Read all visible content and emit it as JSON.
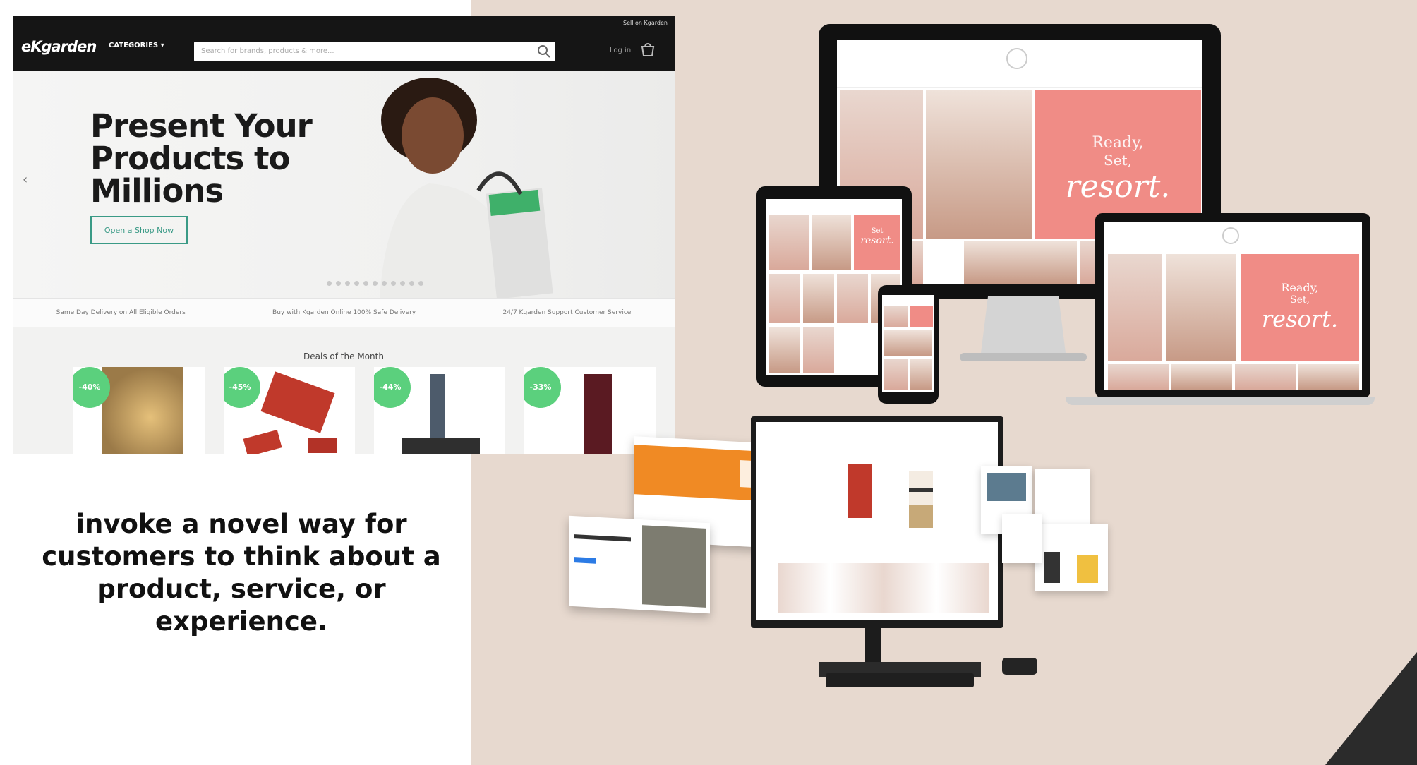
{
  "website": {
    "logo": "eKgarden",
    "categories_label": "CATEGORIES ▾",
    "search_placeholder": "Search for brands, products & more...",
    "top_link": "Sell on Kgarden",
    "login_label": "Log in",
    "hero_title": "Present Your Products to Millions",
    "cta_label": "Open a Shop Now",
    "features": [
      "Same Day Delivery on All Eligible Orders",
      "Buy with Kgarden Online 100% Safe Delivery",
      "24/7 Kgarden Support Customer Service"
    ],
    "deals_heading": "Deals of the Month",
    "products": [
      {
        "badge": "-40%"
      },
      {
        "badge": "-45%"
      },
      {
        "badge": "-44%"
      },
      {
        "badge": "-33%"
      }
    ]
  },
  "tagline": "invoke a novel way for customers to think about a product, service, or experience.",
  "devices": {
    "desktop_promo": {
      "line1": "Ready,",
      "line2": "Set,",
      "line3": "resort."
    },
    "laptop_promo": {
      "line1": "Ready,",
      "line2": "Set,",
      "line3": "resort."
    },
    "tablet_promo": {
      "line1": "Set",
      "line2": "resort."
    }
  },
  "colors": {
    "background_right": "#e7d9cf",
    "hero_accent": "#3a9a86",
    "badge_green": "#5bd07d",
    "promo_pink": "#f08c86"
  }
}
